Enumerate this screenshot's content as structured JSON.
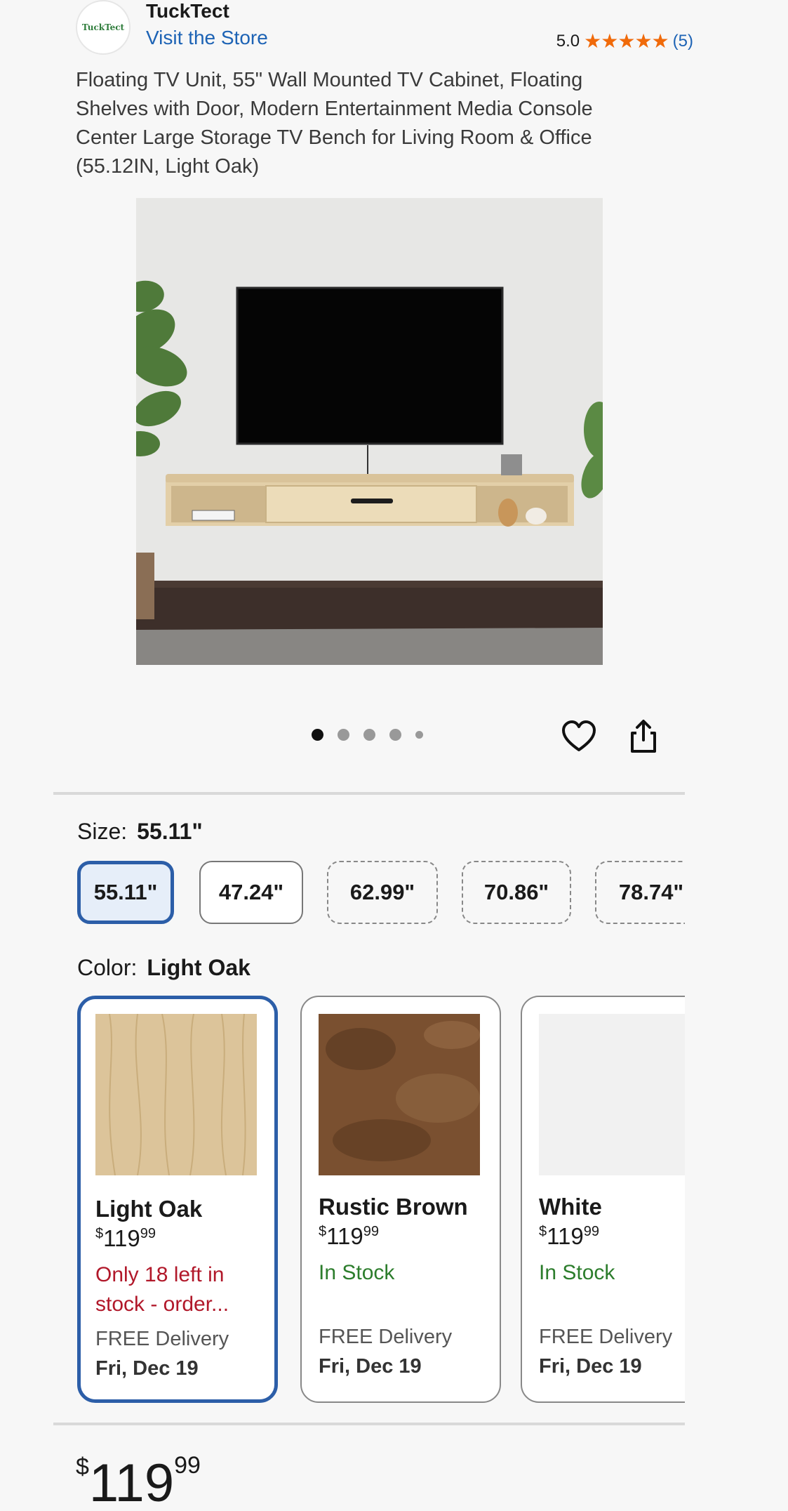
{
  "store": {
    "logo_text": "TuckTect",
    "name": "TuckTect",
    "link": "Visit the Store",
    "rating": "5.0",
    "stars": "★★★★★",
    "review_count": "(5)"
  },
  "product": {
    "title": "Floating TV Unit, 55\" Wall Mounted TV Cabinet, Floating Shelves with Door, Modern Entertainment Media Console Center Large Storage TV Bench for Living Room & Office (55.12IN, Light Oak)",
    "image_count": 5,
    "active_image": 1
  },
  "size": {
    "label": "Size:",
    "selected": "55.11\"",
    "options": [
      {
        "label": "55.11\"",
        "state": "selected"
      },
      {
        "label": "47.24\"",
        "state": "available"
      },
      {
        "label": "62.99\"",
        "state": "unavailable"
      },
      {
        "label": "70.86\"",
        "state": "unavailable"
      },
      {
        "label": "78.74\"",
        "state": "unavailable"
      }
    ]
  },
  "color": {
    "label": "Color:",
    "selected": "Light Oak",
    "options": [
      {
        "name": "Light Oak",
        "currency": "$",
        "dollars": "119",
        "cents": "99",
        "stock": "Only 18 left in stock - order...",
        "stock_type": "low",
        "delivery": "FREE Delivery",
        "date": "Fri, Dec 19",
        "swatch_color": "#dcc49a"
      },
      {
        "name": "Rustic Brown",
        "currency": "$",
        "dollars": "119",
        "cents": "99",
        "stock": "In Stock",
        "stock_type": "ok",
        "delivery": "FREE Delivery",
        "date": "Fri, Dec 19",
        "swatch_color": "#7a5030"
      },
      {
        "name": "White",
        "currency": "$",
        "dollars": "119",
        "cents": "99",
        "stock": "In Stock",
        "stock_type": "ok",
        "delivery": "FREE Delivery",
        "date": "Fri, Dec 19",
        "swatch_color": "#f1f1f1"
      }
    ]
  },
  "price": {
    "currency": "$",
    "dollars": "119",
    "cents": "99"
  },
  "colors": {
    "link": "#1d63b5",
    "star": "#f06a0a",
    "selected_border": "#2c5ea8",
    "low_stock": "#b1182a",
    "in_stock": "#2c7d2c"
  }
}
